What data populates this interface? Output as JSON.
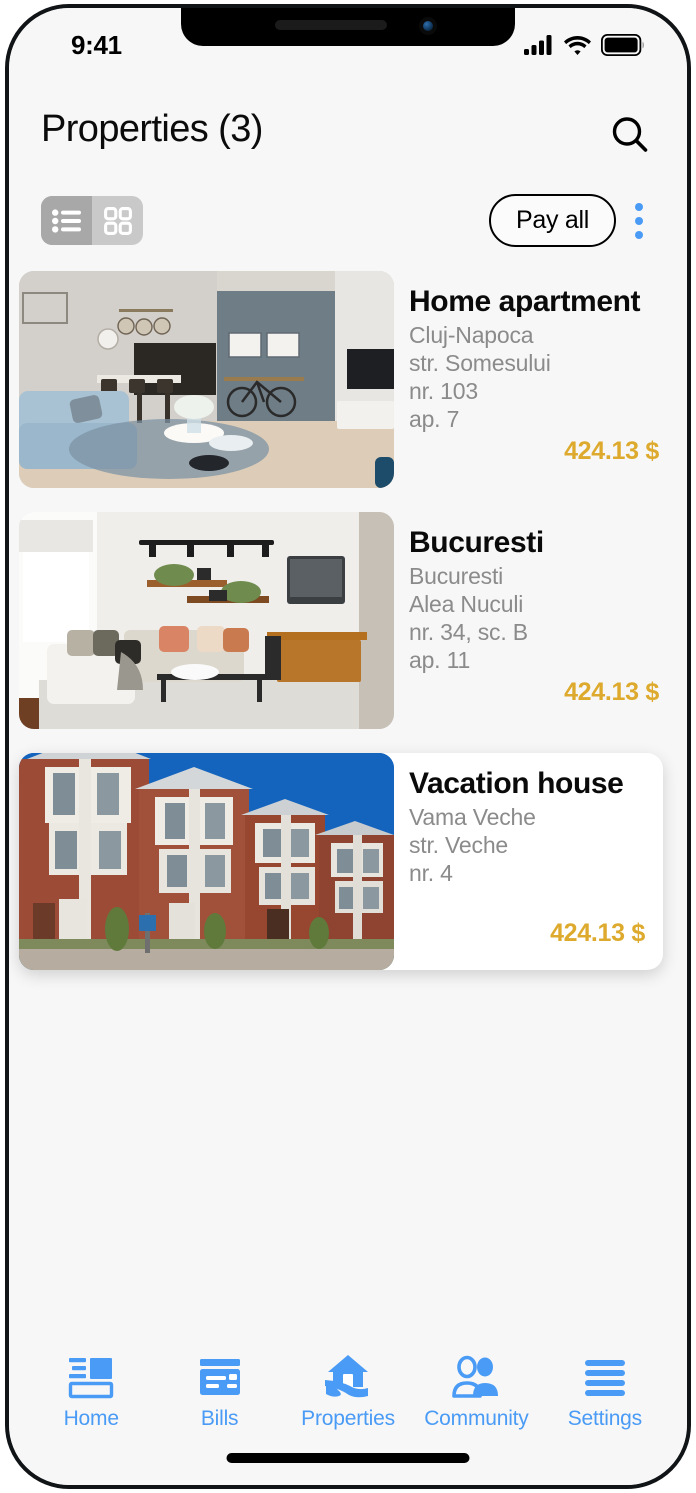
{
  "status_bar": {
    "time": "9:41",
    "signal_icon": "cellular-signal-icon",
    "wifi_icon": "wifi-icon",
    "battery_icon": "battery-full-icon"
  },
  "header": {
    "title": "Properties (3)",
    "search_icon": "search-icon"
  },
  "toolbar": {
    "view_list_icon": "list-view-icon",
    "view_grid_icon": "grid-view-icon",
    "active_view": "list",
    "pay_all_label": "Pay all",
    "more_icon": "more-vertical-icon"
  },
  "properties": [
    {
      "name": "Home apartment",
      "address_lines": [
        "Cluj-Napoca",
        "str. Somesului",
        "nr. 103",
        "ap. 7"
      ],
      "price": "424.13 $",
      "image": "living-room-interior-photo",
      "elevated": false
    },
    {
      "name": "Bucuresti",
      "address_lines": [
        "Bucuresti",
        "Alea Nuculi",
        "nr. 34, sc. B",
        "ap. 11"
      ],
      "price": "424.13 $",
      "image": "white-living-room-photo",
      "elevated": false
    },
    {
      "name": "Vacation house",
      "address_lines": [
        "Vama Veche",
        "str. Veche",
        "nr. 4"
      ],
      "price": "424.13 $",
      "image": "brick-apartment-building-photo",
      "elevated": true
    }
  ],
  "tabbar": {
    "active": "Properties",
    "items": [
      {
        "label": "Home",
        "icon": "dashboard-icon"
      },
      {
        "label": "Bills",
        "icon": "credit-card-icon"
      },
      {
        "label": "Properties",
        "icon": "house-in-hand-icon"
      },
      {
        "label": "Community",
        "icon": "people-icon"
      },
      {
        "label": "Settings",
        "icon": "menu-lines-icon"
      }
    ]
  },
  "colors": {
    "accent_blue": "#4a9bf5",
    "price_gold": "#ddaa2d",
    "muted_text": "#8b8b8b",
    "screen_bg": "#f7f7f7"
  }
}
